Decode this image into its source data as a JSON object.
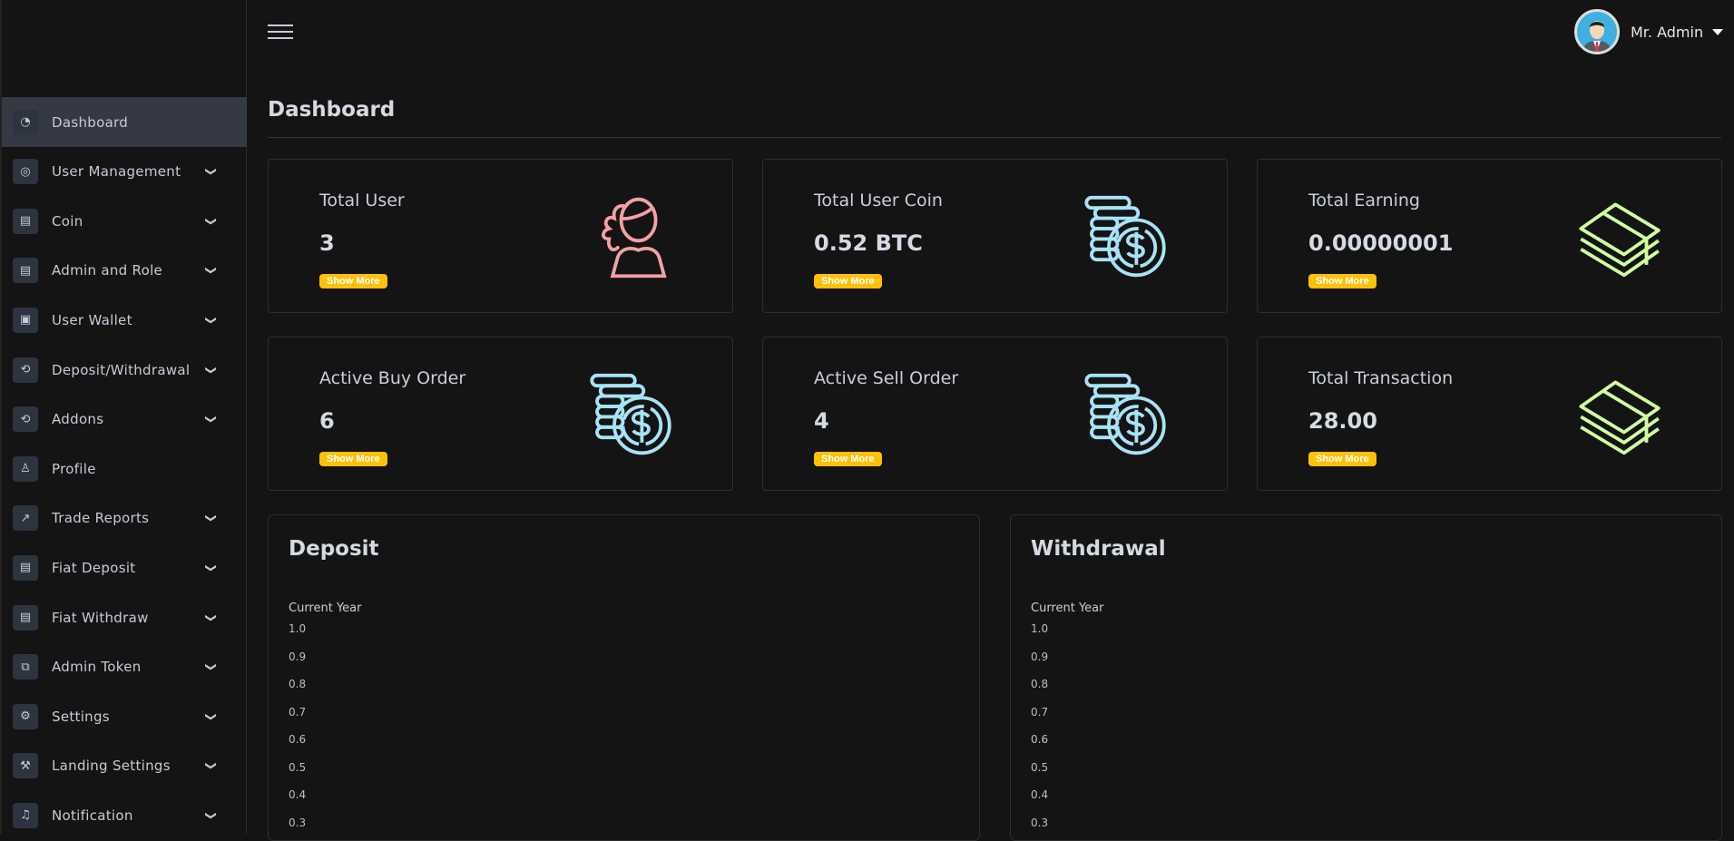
{
  "header": {
    "user_name": "Mr. Admin",
    "page_title": "Dashboard"
  },
  "sidebar": {
    "items": [
      {
        "label": "Dashboard",
        "icon": "speedometer-icon",
        "expandable": false,
        "active": true
      },
      {
        "label": "User Management",
        "icon": "user-circle-icon",
        "expandable": true
      },
      {
        "label": "Coin",
        "icon": "coin-icon",
        "expandable": true
      },
      {
        "label": "Admin and Role",
        "icon": "coin-icon",
        "expandable": true
      },
      {
        "label": "User Wallet",
        "icon": "wallet-icon",
        "expandable": true
      },
      {
        "label": "Deposit/Withdrawal",
        "icon": "exchange-icon",
        "expandable": true
      },
      {
        "label": "Addons",
        "icon": "exchange-icon",
        "expandable": true
      },
      {
        "label": "Profile",
        "icon": "user-icon",
        "expandable": false
      },
      {
        "label": "Trade Reports",
        "icon": "chart-icon",
        "expandable": true
      },
      {
        "label": "Fiat Deposit",
        "icon": "coin-icon",
        "expandable": true
      },
      {
        "label": "Fiat Withdraw",
        "icon": "coin-icon",
        "expandable": true
      },
      {
        "label": "Admin Token",
        "icon": "token-icon",
        "expandable": true
      },
      {
        "label": "Settings",
        "icon": "gear-icon",
        "expandable": true
      },
      {
        "label": "Landing Settings",
        "icon": "hammer-icon",
        "expandable": true
      },
      {
        "label": "Notification",
        "icon": "bell-icon",
        "expandable": true
      }
    ]
  },
  "cards": [
    {
      "label": "Total User",
      "value": "3",
      "button": "Show More",
      "icon": "users-icon",
      "color": "#f4a0a4"
    },
    {
      "label": "Total User Coin",
      "value": "0.52 BTC",
      "button": "Show More",
      "icon": "coins-icon",
      "color": "#a6e3f7"
    },
    {
      "label": "Total Earning",
      "value": "0.00000001",
      "button": "Show More",
      "icon": "money-stack-icon",
      "color": "#cfffa0"
    },
    {
      "label": "Active Buy Order",
      "value": "6",
      "button": "Show More",
      "icon": "coins-icon",
      "color": "#a6e3f7"
    },
    {
      "label": "Active Sell Order",
      "value": "4",
      "button": "Show More",
      "icon": "coins-icon",
      "color": "#a6e3f7"
    },
    {
      "label": "Total Transaction",
      "value": "28.00",
      "button": "Show More",
      "icon": "money-stack-icon",
      "color": "#cfffa0"
    }
  ],
  "chart_data": [
    {
      "type": "line",
      "title": "Deposit",
      "legend": "Current Year",
      "yticks": [
        "1.0",
        "0.9",
        "0.8",
        "0.7",
        "0.6",
        "0.5",
        "0.4",
        "0.3"
      ],
      "series": []
    },
    {
      "type": "line",
      "title": "Withdrawal",
      "legend": "Current Year",
      "yticks": [
        "1.0",
        "0.9",
        "0.8",
        "0.7",
        "0.6",
        "0.5",
        "0.4",
        "0.3"
      ],
      "series": []
    }
  ]
}
